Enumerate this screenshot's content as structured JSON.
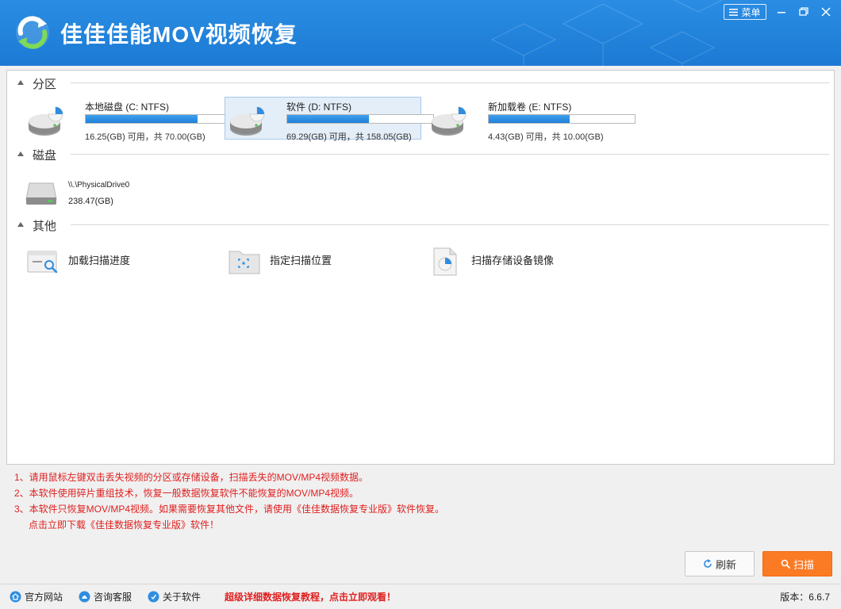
{
  "app": {
    "title": "佳佳佳能MOV视频恢复",
    "menu_label": "菜单"
  },
  "sections": {
    "partitions": "分区",
    "disks": "磁盘",
    "others": "其他"
  },
  "partitions": [
    {
      "name": "本地磁盘 (C: NTFS)",
      "size_text": "16.25(GB) 可用，共 70.00(GB)",
      "used_fraction": 0.768,
      "selected": false
    },
    {
      "name": "软件 (D: NTFS)",
      "size_text": "69.29(GB) 可用，共 158.05(GB)",
      "used_fraction": 0.562,
      "selected": true
    },
    {
      "name": "新加载卷 (E: NTFS)",
      "size_text": "4.43(GB) 可用，共 10.00(GB)",
      "used_fraction": 0.557,
      "selected": false
    }
  ],
  "disks": [
    {
      "name": "\\\\.\\PhysicalDrive0",
      "size_text": "238.47(GB)"
    }
  ],
  "others": [
    {
      "label": "加载扫描进度",
      "icon": "load-scan-progress-icon"
    },
    {
      "label": "指定扫描位置",
      "icon": "folder-target-icon"
    },
    {
      "label": "扫描存储设备镜像",
      "icon": "disk-image-file-icon"
    }
  ],
  "tips": [
    "1、请用鼠标左键双击丢失视频的分区或存储设备，扫描丢失的MOV/MP4视频数据。",
    "2、本软件使用碎片重组技术，恢复一般数据恢复软件不能恢复的MOV/MP4视频。",
    "3、本软件只恢复MOV/MP4视频。如果需要恢复其他文件，请使用《佳佳数据恢复专业版》软件恢复。",
    "点击立即下载《佳佳数据恢复专业版》软件！"
  ],
  "buttons": {
    "refresh": "刷新",
    "scan": "扫描"
  },
  "statusbar": {
    "website": "官方网站",
    "support": "咨询客服",
    "about": "关于软件",
    "promo": "超级详细数据恢复教程，点击立即观看！",
    "version": "版本：6.6.7"
  },
  "colors": {
    "title_bar": "#1c7ad4",
    "scan_button": "#fb7a24",
    "tip_text": "#e02020",
    "progress_fill": "#1f80d8"
  }
}
